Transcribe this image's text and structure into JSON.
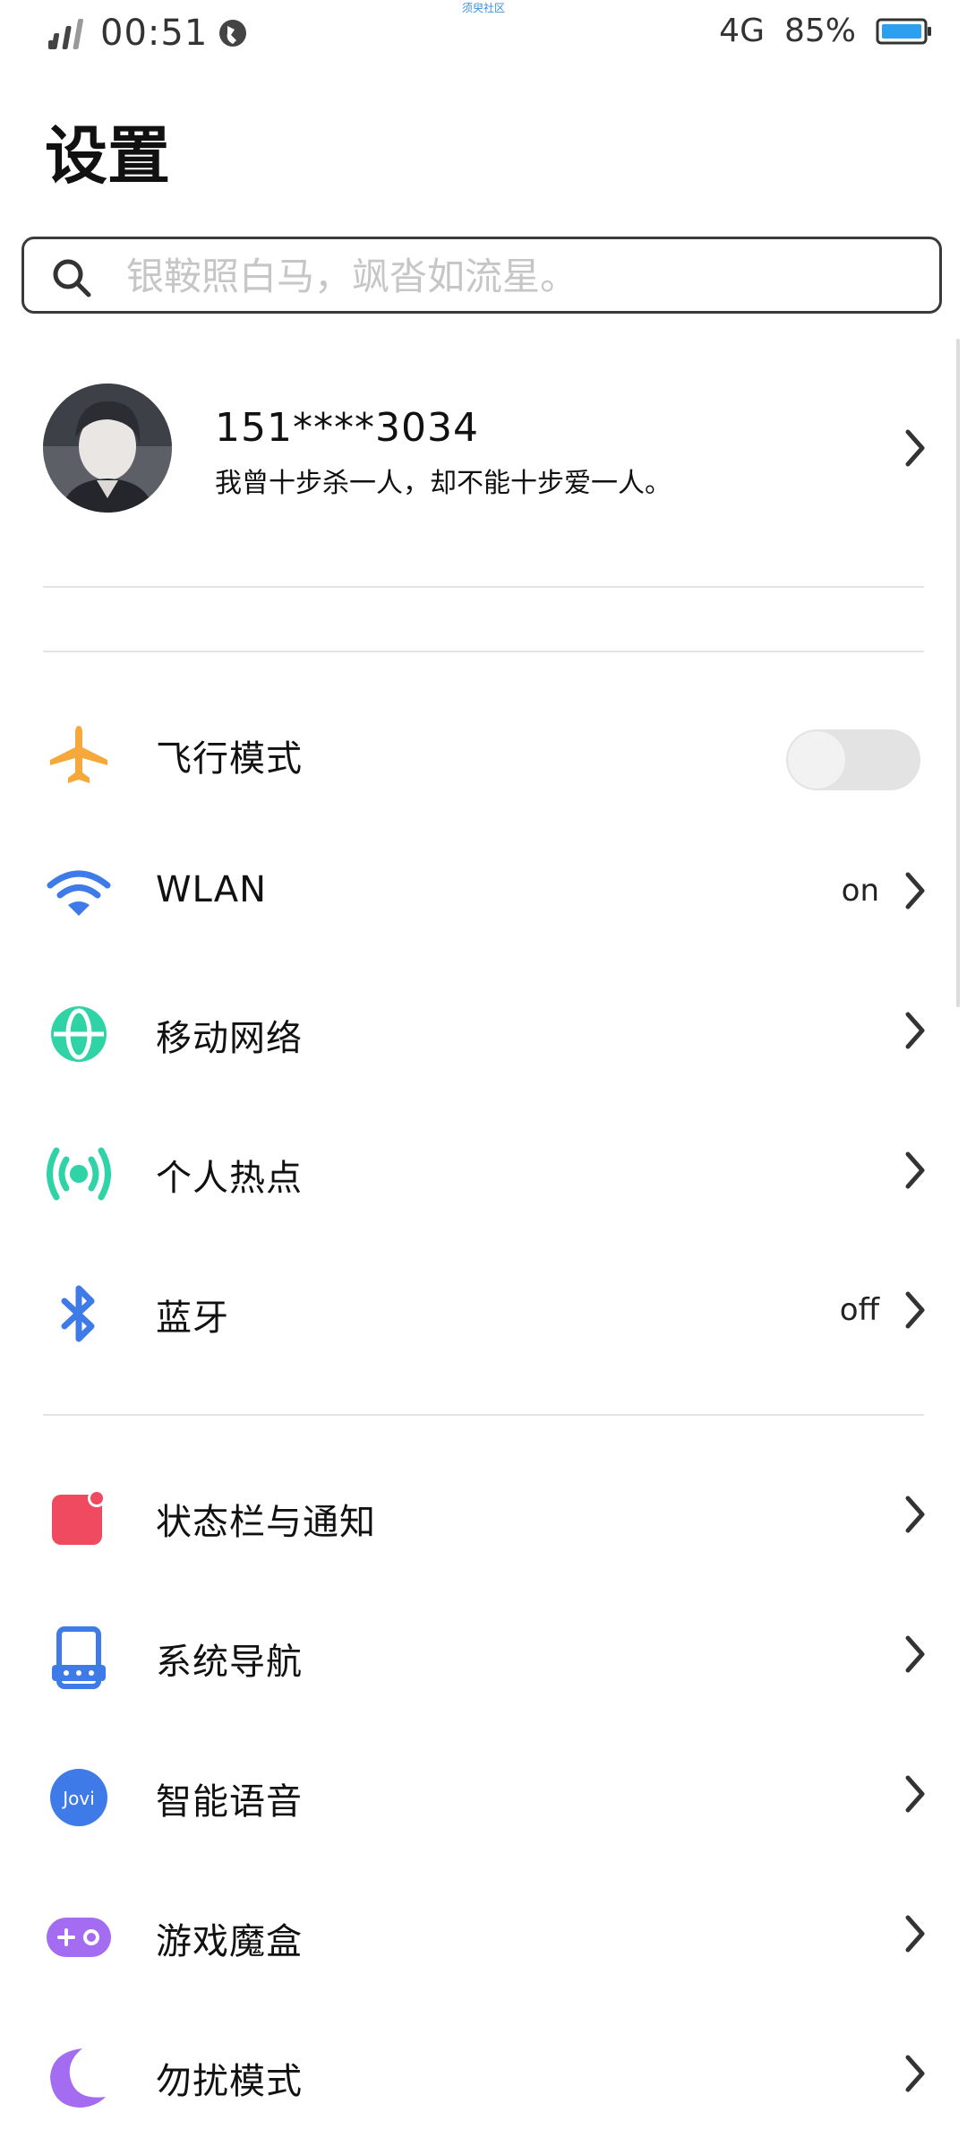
{
  "status_bar": {
    "time": "00:51",
    "network": "4G",
    "battery": "85%",
    "top_caption": "须臾社区"
  },
  "page": {
    "title": "设置"
  },
  "search": {
    "placeholder": "银鞍照白马，飒沓如流星。"
  },
  "profile": {
    "name": "151****3034",
    "motto": "我曾十步杀一人，却不能十步爱一人。"
  },
  "settings": [
    {
      "label": "飞行模式",
      "icon": "airplane-icon",
      "color": "#f6a83a",
      "toggle": false
    },
    {
      "label": "WLAN",
      "icon": "wifi-icon",
      "color": "#3f7be8",
      "value": "on"
    },
    {
      "label": "移动网络",
      "icon": "globe-icon",
      "color": "#2fd3a5"
    },
    {
      "label": "个人热点",
      "icon": "hotspot-icon",
      "color": "#2fd3a5"
    },
    {
      "label": "蓝牙",
      "icon": "bluetooth-icon",
      "color": "#3f7be8",
      "value": "off"
    },
    {
      "label": "状态栏与通知",
      "icon": "notification-icon",
      "color": "#f04a60"
    },
    {
      "label": "系统导航",
      "icon": "navigation-icon",
      "color": "#3f7be8"
    },
    {
      "label": "智能语音",
      "icon": "jovi-icon",
      "color": "#3f7be8",
      "icon_text": "Jovi"
    },
    {
      "label": "游戏魔盒",
      "icon": "gamepad-icon",
      "color": "#a46cf0"
    },
    {
      "label": "勿扰模式",
      "icon": "moon-icon",
      "color": "#a46cf0"
    }
  ]
}
